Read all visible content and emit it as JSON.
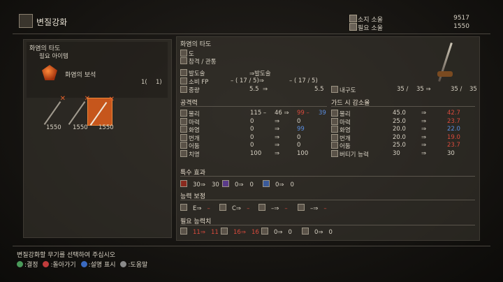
{
  "header": {
    "title": "변질강화"
  },
  "souls": [
    {
      "label": "소지 소울",
      "value": "9517"
    },
    {
      "label": "필요 소울",
      "value": "1550"
    }
  ],
  "left": {
    "weapon_name": "화염의 타도",
    "required_label": "필요 아이템",
    "item_name": "화염의 보석",
    "item_qty_a": "1(",
    "item_qty_b": "1)",
    "weapon_costs": [
      "1550",
      "1550",
      "1550"
    ]
  },
  "weapon": {
    "name": "화염의 타도",
    "type": "도",
    "attack_type": "참격 / 관통",
    "skill_label": "발도술",
    "skill_label_after": "⇒발도술",
    "fp_label": "소비 FP",
    "fp_before": "– ( 17 / 5)⇒",
    "fp_after": "– ( 17 / 5)",
    "weight_label": "중량",
    "weight_before": "5.5",
    "weight_after": "5.5",
    "durability_label": "내구도",
    "dur_a": "35 /",
    "dur_b": "35 ⇒",
    "dur_c": "35 /",
    "dur_d": "35"
  },
  "attack": {
    "title": "공격력",
    "rows": [
      {
        "label": "물리",
        "base": "115 –",
        "add": "46 ⇒",
        "after": "99 –",
        "after2": "39",
        "after_color": "red",
        "after2_color": "blue"
      },
      {
        "label": "마력",
        "base": "0",
        "add": "⇒",
        "after": "0",
        "after2": "",
        "after_color": "",
        "after2_color": ""
      },
      {
        "label": "화염",
        "base": "0",
        "add": "⇒",
        "after": "99",
        "after2": "",
        "after_color": "blue",
        "after2_color": ""
      },
      {
        "label": "번개",
        "base": "0",
        "add": "⇒",
        "after": "0",
        "after2": "",
        "after_color": "",
        "after2_color": ""
      },
      {
        "label": "어둠",
        "base": "0",
        "add": "⇒",
        "after": "0",
        "after2": "",
        "after_color": "",
        "after2_color": ""
      },
      {
        "label": "치명",
        "base": "100",
        "add": "⇒",
        "after": "100",
        "after2": "",
        "after_color": "",
        "after2_color": ""
      }
    ]
  },
  "guard": {
    "title": "가드 시 감소율",
    "rows": [
      {
        "label": "물리",
        "before": "45.0",
        "arrow": "⇒",
        "after": "42.7",
        "after_color": "red"
      },
      {
        "label": "마력",
        "before": "25.0",
        "arrow": "⇒",
        "after": "23.7",
        "after_color": "red"
      },
      {
        "label": "화염",
        "before": "20.0",
        "arrow": "⇒",
        "after": "22.0",
        "after_color": "blue"
      },
      {
        "label": "번개",
        "before": "20.0",
        "arrow": "⇒",
        "after": "19.0",
        "after_color": "red"
      },
      {
        "label": "어둠",
        "before": "25.0",
        "arrow": "⇒",
        "after": "23.7",
        "after_color": "red"
      },
      {
        "label": "버티기 능력",
        "before": "30",
        "arrow": "⇒",
        "after": "30",
        "after_color": ""
      }
    ]
  },
  "special": {
    "title": "특수 효과",
    "items": [
      {
        "before": "30⇒",
        "after": "30"
      },
      {
        "before": "0⇒",
        "after": "0"
      },
      {
        "before": "0⇒",
        "after": "0"
      }
    ]
  },
  "scaling": {
    "title": "능력 보정",
    "items": [
      {
        "before": "E⇒",
        "after": "–"
      },
      {
        "before": "C⇒",
        "after": "–"
      },
      {
        "before": "–⇒",
        "after": "–"
      },
      {
        "before": "–⇒",
        "after": "–"
      }
    ]
  },
  "requirements": {
    "title": "필요 능력치",
    "items": [
      {
        "before": "11⇒",
        "after": "11",
        "color": "red"
      },
      {
        "before": "16⇒",
        "after": "16",
        "color": "red"
      },
      {
        "before": "0⇒",
        "after": "0",
        "color": ""
      },
      {
        "before": "0⇒",
        "after": "0",
        "color": ""
      }
    ]
  },
  "footer": {
    "hint": "변질강화할 무기를 선택하여 주십시오",
    "actions": [
      {
        "label": ":결정",
        "color": "#4a9a5a"
      },
      {
        "label": ":돌아가기",
        "color": "#c03c3c"
      },
      {
        "label": ":설명 표시",
        "color": "#3a6ac0"
      },
      {
        "label": ":도움말",
        "color": "#8a8a8a"
      }
    ]
  }
}
